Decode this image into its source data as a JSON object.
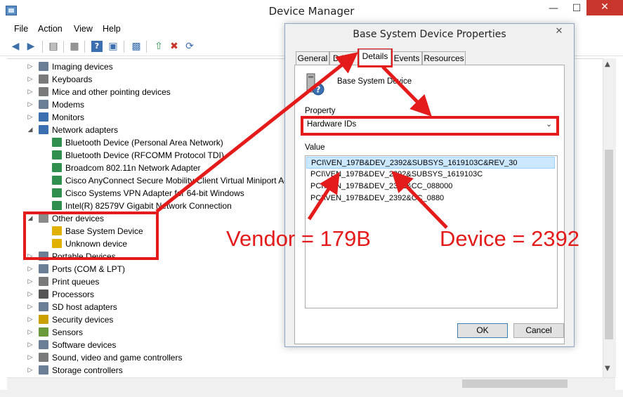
{
  "window": {
    "title": "Device Manager",
    "minimize": "—",
    "maximize": "☐",
    "close": "✕"
  },
  "menu": [
    "File",
    "Action",
    "View",
    "Help"
  ],
  "toolbar": [
    "back-icon",
    "forward-icon",
    "show-hide-tree-icon",
    "properties-icon",
    "help-icon",
    "device-view-icon",
    "monitor-icon",
    "update-driver-icon",
    "uninstall-icon",
    "scan-hardware-icon"
  ],
  "tree": [
    {
      "label": "Imaging devices",
      "expander": "▷",
      "level": 0,
      "icon_color": "#6a7f96"
    },
    {
      "label": "Keyboards",
      "expander": "▷",
      "level": 0,
      "icon_color": "#7a7a7a"
    },
    {
      "label": "Mice and other pointing devices",
      "expander": "▷",
      "level": 0,
      "icon_color": "#7a7a7a"
    },
    {
      "label": "Modems",
      "expander": "▷",
      "level": 0,
      "icon_color": "#6a7f96"
    },
    {
      "label": "Monitors",
      "expander": "▷",
      "level": 0,
      "icon_color": "#3b6fb0"
    },
    {
      "label": "Network adapters",
      "expander": "◢",
      "level": 0,
      "icon_color": "#3b6fb0"
    },
    {
      "label": "Bluetooth Device (Personal Area Network)",
      "expander": "",
      "level": 1,
      "icon_color": "#2f8f4f"
    },
    {
      "label": "Bluetooth Device (RFCOMM Protocol TDI)",
      "expander": "",
      "level": 1,
      "icon_color": "#2f8f4f"
    },
    {
      "label": "Broadcom 802.11n Network Adapter",
      "expander": "",
      "level": 1,
      "icon_color": "#2f8f4f"
    },
    {
      "label": "Cisco AnyConnect Secure Mobility Client Virtual Miniport Adapter",
      "expander": "",
      "level": 1,
      "icon_color": "#2f8f4f"
    },
    {
      "label": "Cisco Systems VPN Adapter for 64-bit Windows",
      "expander": "",
      "level": 1,
      "icon_color": "#2f8f4f"
    },
    {
      "label": "Intel(R) 82579V Gigabit Network Connection",
      "expander": "",
      "level": 1,
      "icon_color": "#2f8f4f"
    },
    {
      "label": "Other devices",
      "expander": "◢",
      "level": 0,
      "icon_color": "#8a8a8a"
    },
    {
      "label": "Base System Device",
      "expander": "",
      "level": 1,
      "icon_color": "#e0b100"
    },
    {
      "label": "Unknown device",
      "expander": "",
      "level": 1,
      "icon_color": "#e0b100"
    },
    {
      "label": "Portable Devices",
      "expander": "▷",
      "level": 0,
      "icon_color": "#6a7f96"
    },
    {
      "label": "Ports (COM & LPT)",
      "expander": "▷",
      "level": 0,
      "icon_color": "#6a7f96"
    },
    {
      "label": "Print queues",
      "expander": "▷",
      "level": 0,
      "icon_color": "#7a7a7a"
    },
    {
      "label": "Processors",
      "expander": "▷",
      "level": 0,
      "icon_color": "#555555"
    },
    {
      "label": "SD host adapters",
      "expander": "▷",
      "level": 0,
      "icon_color": "#6a7f96"
    },
    {
      "label": "Security devices",
      "expander": "▷",
      "level": 0,
      "icon_color": "#c9a000"
    },
    {
      "label": "Sensors",
      "expander": "▷",
      "level": 0,
      "icon_color": "#6a9a3a"
    },
    {
      "label": "Software devices",
      "expander": "▷",
      "level": 0,
      "icon_color": "#6a7f96"
    },
    {
      "label": "Sound, video and game controllers",
      "expander": "▷",
      "level": 0,
      "icon_color": "#7a7a7a"
    },
    {
      "label": "Storage controllers",
      "expander": "▷",
      "level": 0,
      "icon_color": "#6a7f96"
    }
  ],
  "dialog": {
    "title": "Base System Device Properties",
    "close": "✕",
    "tabs": [
      "General",
      "Driver",
      "Details",
      "Events",
      "Resources"
    ],
    "active_tab": "Details",
    "device_name": "Base System Device",
    "property_label": "Property",
    "property_value": "Hardware IDs",
    "value_label": "Value",
    "values": [
      "PCI\\VEN_197B&DEV_2392&SUBSYS_1619103C&REV_30",
      "PCI\\VEN_197B&DEV_2392&SUBSYS_1619103C",
      "PCI\\VEN_197B&DEV_2392&CC_088000",
      "PCI\\VEN_197B&DEV_2392&CC_0880"
    ],
    "ok": "OK",
    "cancel": "Cancel"
  },
  "annotations": {
    "vendor": "Vendor = 179B",
    "device": "Device = 2392",
    "color": "#e41b1b"
  }
}
